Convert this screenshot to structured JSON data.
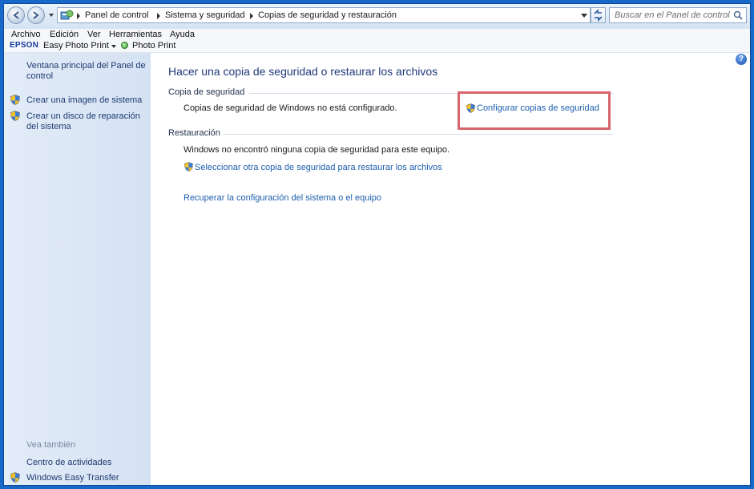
{
  "address": {
    "breadcrumbs": [
      "Panel de control",
      "Sistema y seguridad",
      "Copias de seguridad y restauración"
    ],
    "search_placeholder": "Buscar en el Panel de control"
  },
  "menubar": [
    "Archivo",
    "Edición",
    "Ver",
    "Herramientas",
    "Ayuda"
  ],
  "epson_toolbar": {
    "brand": "EPSON",
    "easy_photo_print": "Easy Photo Print",
    "photo_print": "Photo Print"
  },
  "sidebar": {
    "home": "Ventana principal del Panel de control",
    "items": [
      {
        "label": "Crear una imagen de sistema",
        "icon": "shield-icon"
      },
      {
        "label": "Crear un disco de reparación del sistema",
        "icon": "shield-icon"
      }
    ],
    "see_also_title": "Vea también",
    "see_also": [
      {
        "label": "Centro de actividades"
      },
      {
        "label": "Windows Easy Transfer",
        "icon": "shield-icon"
      }
    ]
  },
  "main": {
    "title": "Hacer una copia de seguridad o restaurar los archivos",
    "backup": {
      "heading": "Copia de seguridad",
      "status": "Copias de seguridad de Windows no está configurado.",
      "configure_link": "Configurar copias de seguridad"
    },
    "restore": {
      "heading": "Restauración",
      "status": "Windows no encontró ninguna copia de seguridad para este equipo.",
      "select_link": "Seleccionar otra copia de seguridad para restaurar los archivos",
      "recover_link": "Recuperar la configuración del sistema o el equipo"
    }
  },
  "help_icon": "?",
  "colors": {
    "frame": "#1768c8",
    "link": "#1d5fae",
    "title": "#1f3a7a",
    "highlight": "#d9636b"
  }
}
